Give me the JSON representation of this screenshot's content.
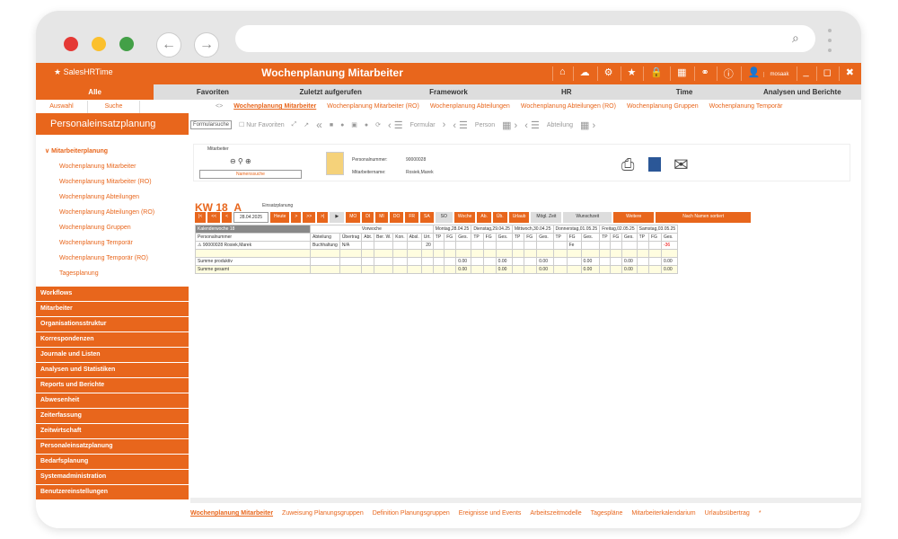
{
  "colors": {
    "accent": "#e8661c"
  },
  "window": {
    "search_icon": "search-icon"
  },
  "app": {
    "logo_text": "SalesHRTime",
    "title": "Wochenplanung Mitarbeiter",
    "user": "mosaak"
  },
  "main_nav": [
    "Alle",
    "Favoriten",
    "Zuletzt aufgerufen",
    "Framework",
    "HR",
    "Time",
    "Analysen und Berichte"
  ],
  "subnav": [
    "Auswahl",
    "Suche"
  ],
  "sidebar": {
    "heading": "Personaleinsatzplanung",
    "group": "Mitarbeiterplanung",
    "items": [
      "Wochenplanung Mitarbeiter",
      "Wochenplanung Mitarbeiter (RO)",
      "Wochenplanung Abteilungen",
      "Wochenplanung Abteilungen (RO)",
      "Wochenplanung Gruppen",
      "Wochenplanung Temporär",
      "Wochenplanung Temporär (RO)",
      "Tagesplanung"
    ],
    "categories": [
      "Workflows",
      "Mitarbeiter",
      "Organisationsstruktur",
      "Korrespondenzen",
      "Journale und Listen",
      "Analysen und Statistiken",
      "Reports und Berichte",
      "Abwesenheit",
      "Zeiterfassung",
      "Zeitwirtschaft",
      "Personaleinsatzplanung",
      "Bedarfsplanung",
      "Systemadministration",
      "Benutzereinstellungen"
    ]
  },
  "content_tabs": [
    "Wochenplanung Mitarbeiter",
    "Wochenplanung Mitarbeiter (RO)",
    "Wochenplanung Abteilungen",
    "Wochenplanung Abteilungen (RO)",
    "Wochenplanung Gruppen",
    "Wochenplanung Temporär"
  ],
  "toolbar": {
    "form_search": "Formularsuche",
    "only_fav": "Nur Favoriten",
    "formular": "Formular",
    "person": "Person",
    "abteilung": "Abteilung"
  },
  "employee": {
    "section": "Mitarbeiter",
    "name_search": "Namenssuche",
    "pn_label": "Personalnummer:",
    "pn_value": "90000028",
    "name_label": "Mitarbeitername:",
    "name_value": "Rosiek,Marek"
  },
  "week": {
    "kw": "KW 18",
    "letter": "A",
    "mode": "Einsatzplanung",
    "date": "28.04.2025",
    "btns": [
      "Heute",
      "MO",
      "DI",
      "MI",
      "DO",
      "FR",
      "SA",
      "SO",
      "Woche",
      "Ab.",
      "Üb.",
      "Urlaub",
      "Mögl. Zeit",
      "Wunschzeit",
      "Weitere",
      "Nach Namen sortiert"
    ]
  },
  "grid": {
    "kw_label": "Kalenderwoche 18",
    "prev": "Vorwoche",
    "days": [
      "Montag,28.04.25",
      "Dienstag,29.04.25",
      "Mittwoch,30.04.25",
      "Donnerstag,01.05.25",
      "Freitag,02.05.25",
      "Samstag,03.05.25"
    ],
    "cols": [
      "Personalnummer",
      "Abteilung",
      "Übertrag",
      "Abt.",
      "Ber. W.",
      "Kon.",
      "Absl.",
      "Urt.",
      "TP",
      "FG",
      "Ges."
    ],
    "row": {
      "pn": "90000028",
      "name": "Rosiek,Marek",
      "abt": "Buchhaltung",
      "uebertrag": "N/A",
      "urt": "20",
      "fe": "Fe",
      "red": "-36"
    },
    "sum1": "Summe produktiv",
    "sum2": "Summe gesamt",
    "zero": "0.00"
  },
  "bottom_tabs": [
    "Wochenplanung Mitarbeiter",
    "Zuweisung Planungsgruppen",
    "Definition Planungsgruppen",
    "Ereignisse und Events",
    "Arbeitszeitmodelle",
    "Tagespläne",
    "Mitarbeiterkalendarium",
    "Urlaubsübertrag",
    "*"
  ]
}
